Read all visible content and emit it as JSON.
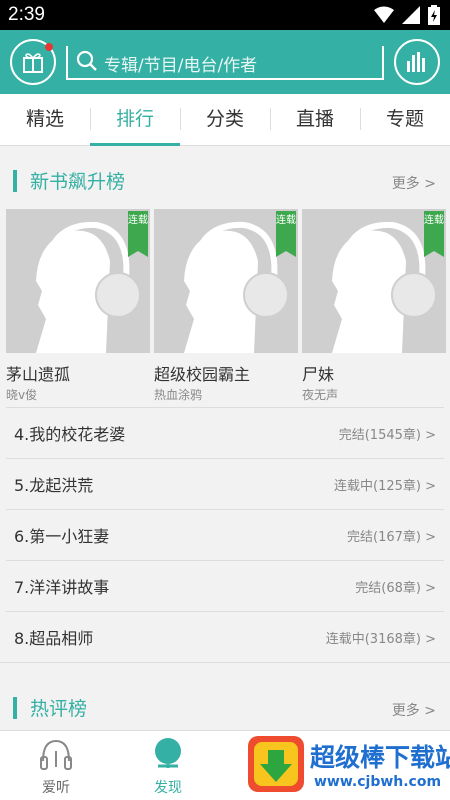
{
  "status_bar": {
    "time": "2:39"
  },
  "search": {
    "placeholder": "专辑/节目/电台/作者"
  },
  "tabs": [
    {
      "label": "精选",
      "active": false
    },
    {
      "label": "排行",
      "active": true
    },
    {
      "label": "分类",
      "active": false
    },
    {
      "label": "直播",
      "active": false
    },
    {
      "label": "专题",
      "active": false
    }
  ],
  "section1": {
    "title": "新书飙升榜",
    "more": "更多 >",
    "top_books": [
      {
        "name": "茅山遗孤",
        "author": "晓v俊",
        "badge": "连载"
      },
      {
        "name": "超级校园霸主",
        "author": "热血涂鸦",
        "badge": "连载"
      },
      {
        "name": "尸妹",
        "author": "夜无声",
        "badge": "连载"
      }
    ],
    "list": [
      {
        "name": "4.我的校花老婆",
        "status": "完结(1545章) >"
      },
      {
        "name": "5.龙起洪荒",
        "status": "连载中(125章) >"
      },
      {
        "name": "6.第一小狂妻",
        "status": "完结(167章) >"
      },
      {
        "name": "7.洋洋讲故事",
        "status": "完结(68章) >"
      },
      {
        "name": "8.超品相师",
        "status": "连载中(3168章) >"
      }
    ]
  },
  "section2": {
    "title": "热评榜",
    "more": "更多 >"
  },
  "bottom_nav": [
    {
      "label": "爱听",
      "icon": "headphones-icon",
      "active": false
    },
    {
      "label": "发现",
      "icon": "globe-icon",
      "active": true
    }
  ],
  "watermark": {
    "brand": "超级棒下载站",
    "url": "www.cjbwh.com"
  },
  "colors": {
    "accent": "#35b0a4",
    "badge": "#3da84e"
  }
}
